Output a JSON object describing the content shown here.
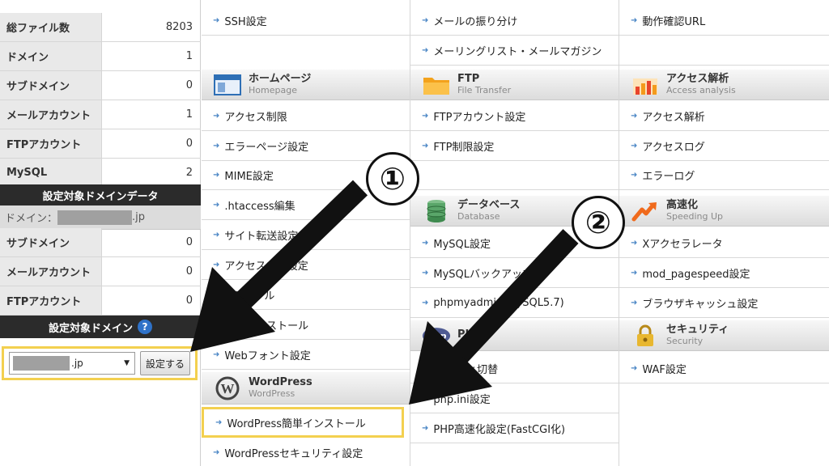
{
  "sidebar": {
    "stats": [
      {
        "label": "総ファイル数",
        "value": "8203"
      },
      {
        "label": "ドメイン",
        "value": "1"
      },
      {
        "label": "サブドメイン",
        "value": "0"
      },
      {
        "label": "メールアカウント",
        "value": "1"
      },
      {
        "label": "FTPアカウント",
        "value": "0"
      },
      {
        "label": "MySQL",
        "value": "2"
      }
    ],
    "domain_data_header": "設定対象ドメインデータ",
    "domain_label": "ドメイン：",
    "domain_suffix": ".jp",
    "domain_stats": [
      {
        "label": "サブドメイン",
        "value": "0"
      },
      {
        "label": "メールアカウント",
        "value": "0"
      },
      {
        "label": "FTPアカウント",
        "value": "0"
      }
    ],
    "target_domain_header": "設定対象ドメイン",
    "help_icon": "?",
    "select_value": ".jp",
    "set_button": "設定する"
  },
  "columns": {
    "col1": {
      "top_item": "SSH設定",
      "homepage": {
        "title": "ホームページ",
        "subtitle": "Homepage",
        "icon": "homepage-window-icon"
      },
      "homepage_items": [
        "アクセス制限",
        "エラーページ設定",
        "MIME設定",
        ".htaccess編集",
        "サイト転送設定",
        "アクセスログ設定",
        "CGIツール",
        "簡単インストール",
        "Webフォント設定"
      ],
      "wordpress": {
        "title": "WordPress",
        "subtitle": "WordPress",
        "icon": "wordpress-logo-icon"
      },
      "wordpress_items": [
        "WordPress簡単インストール",
        "WordPressセキュリティ設定"
      ]
    },
    "col2": {
      "top_items": [
        "メールの振り分け",
        "メーリングリスト・メールマガジン"
      ],
      "ftp": {
        "title": "FTP",
        "subtitle": "File Transfer",
        "icon": "folder-icon"
      },
      "ftp_items": [
        "FTPアカウント設定",
        "FTP制限設定"
      ],
      "database": {
        "title": "データベース",
        "subtitle": "Database",
        "icon": "database-icon"
      },
      "database_items": [
        "MySQL設定",
        "MySQLバックアップ",
        "phpmyadmin(MySQL5.7)"
      ],
      "php": {
        "title": "PHP",
        "subtitle": "",
        "icon": "php-logo-icon"
      },
      "php_items": [
        "PHP Ver.切替",
        "php.ini設定",
        "PHP高速化設定(FastCGI化)"
      ]
    },
    "col3": {
      "top_item": "動作確認URL",
      "access": {
        "title": "アクセス解析",
        "subtitle": "Access analysis",
        "icon": "chart-icon"
      },
      "access_items": [
        "アクセス解析",
        "アクセスログ",
        "エラーログ"
      ],
      "speed": {
        "title": "高速化",
        "subtitle": "Speeding Up",
        "icon": "speed-arrow-icon"
      },
      "speed_items": [
        "Xアクセラレータ",
        "mod_pagespeed設定",
        "ブラウザキャッシュ設定"
      ],
      "security": {
        "title": "セキュリティ",
        "subtitle": "Security",
        "icon": "lock-icon"
      },
      "security_items": [
        "WAF設定"
      ]
    }
  },
  "annotations": {
    "step1": "①",
    "step2": "②",
    "arrow_color": "#111111",
    "highlight_color": "#f3d04f"
  }
}
